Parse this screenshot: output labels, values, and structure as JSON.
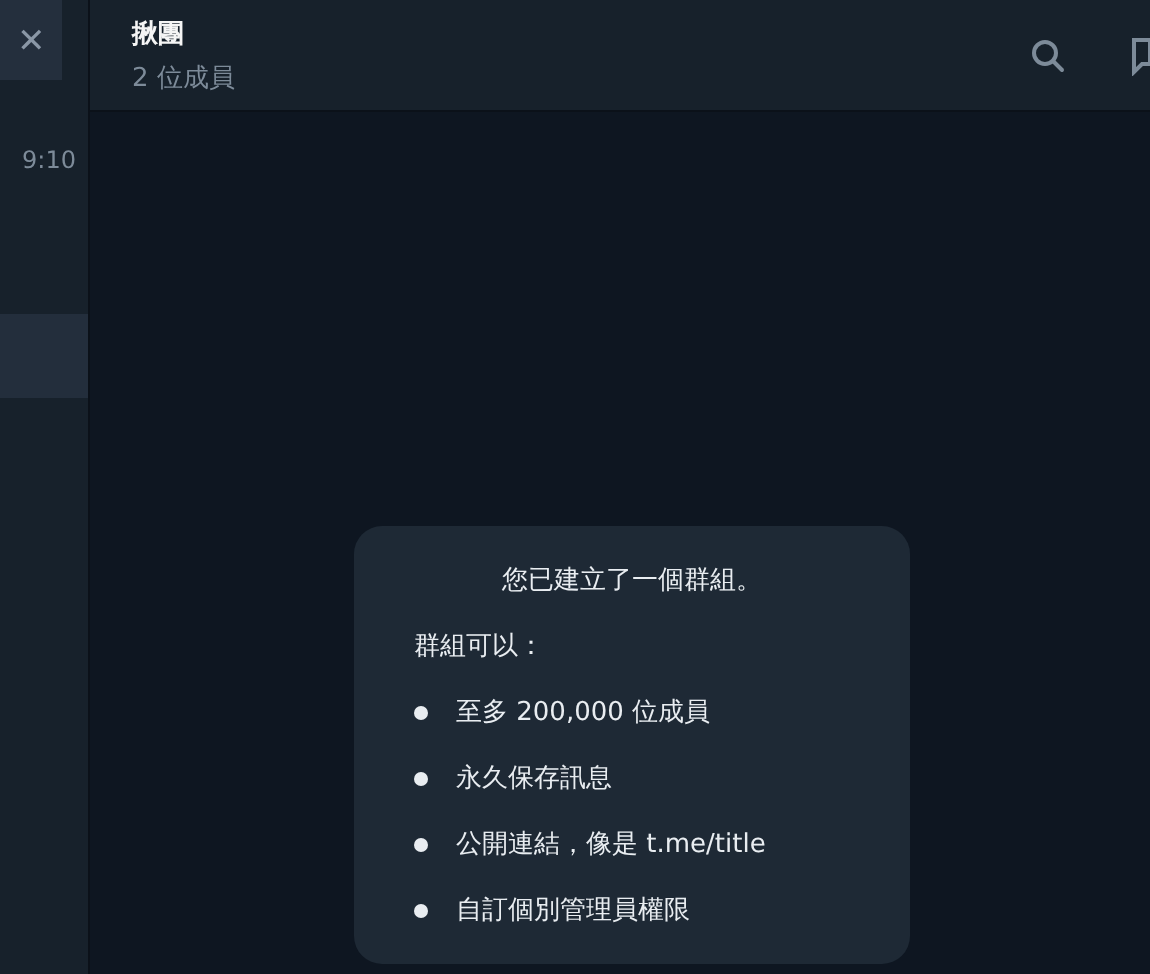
{
  "sidebar": {
    "close_button": "✕",
    "time": "9:10",
    "rows": [
      {
        "selected": true
      }
    ]
  },
  "header": {
    "title": "揪團",
    "subtitle": "2 位成員"
  },
  "service_message": {
    "title": "您已建立了一個群組。",
    "intro": "群組可以：",
    "items": [
      "至多 200,000 位成員",
      "永久保存訊息",
      "公開連結，像是 t.me/title",
      "自訂個別管理員權限"
    ]
  }
}
